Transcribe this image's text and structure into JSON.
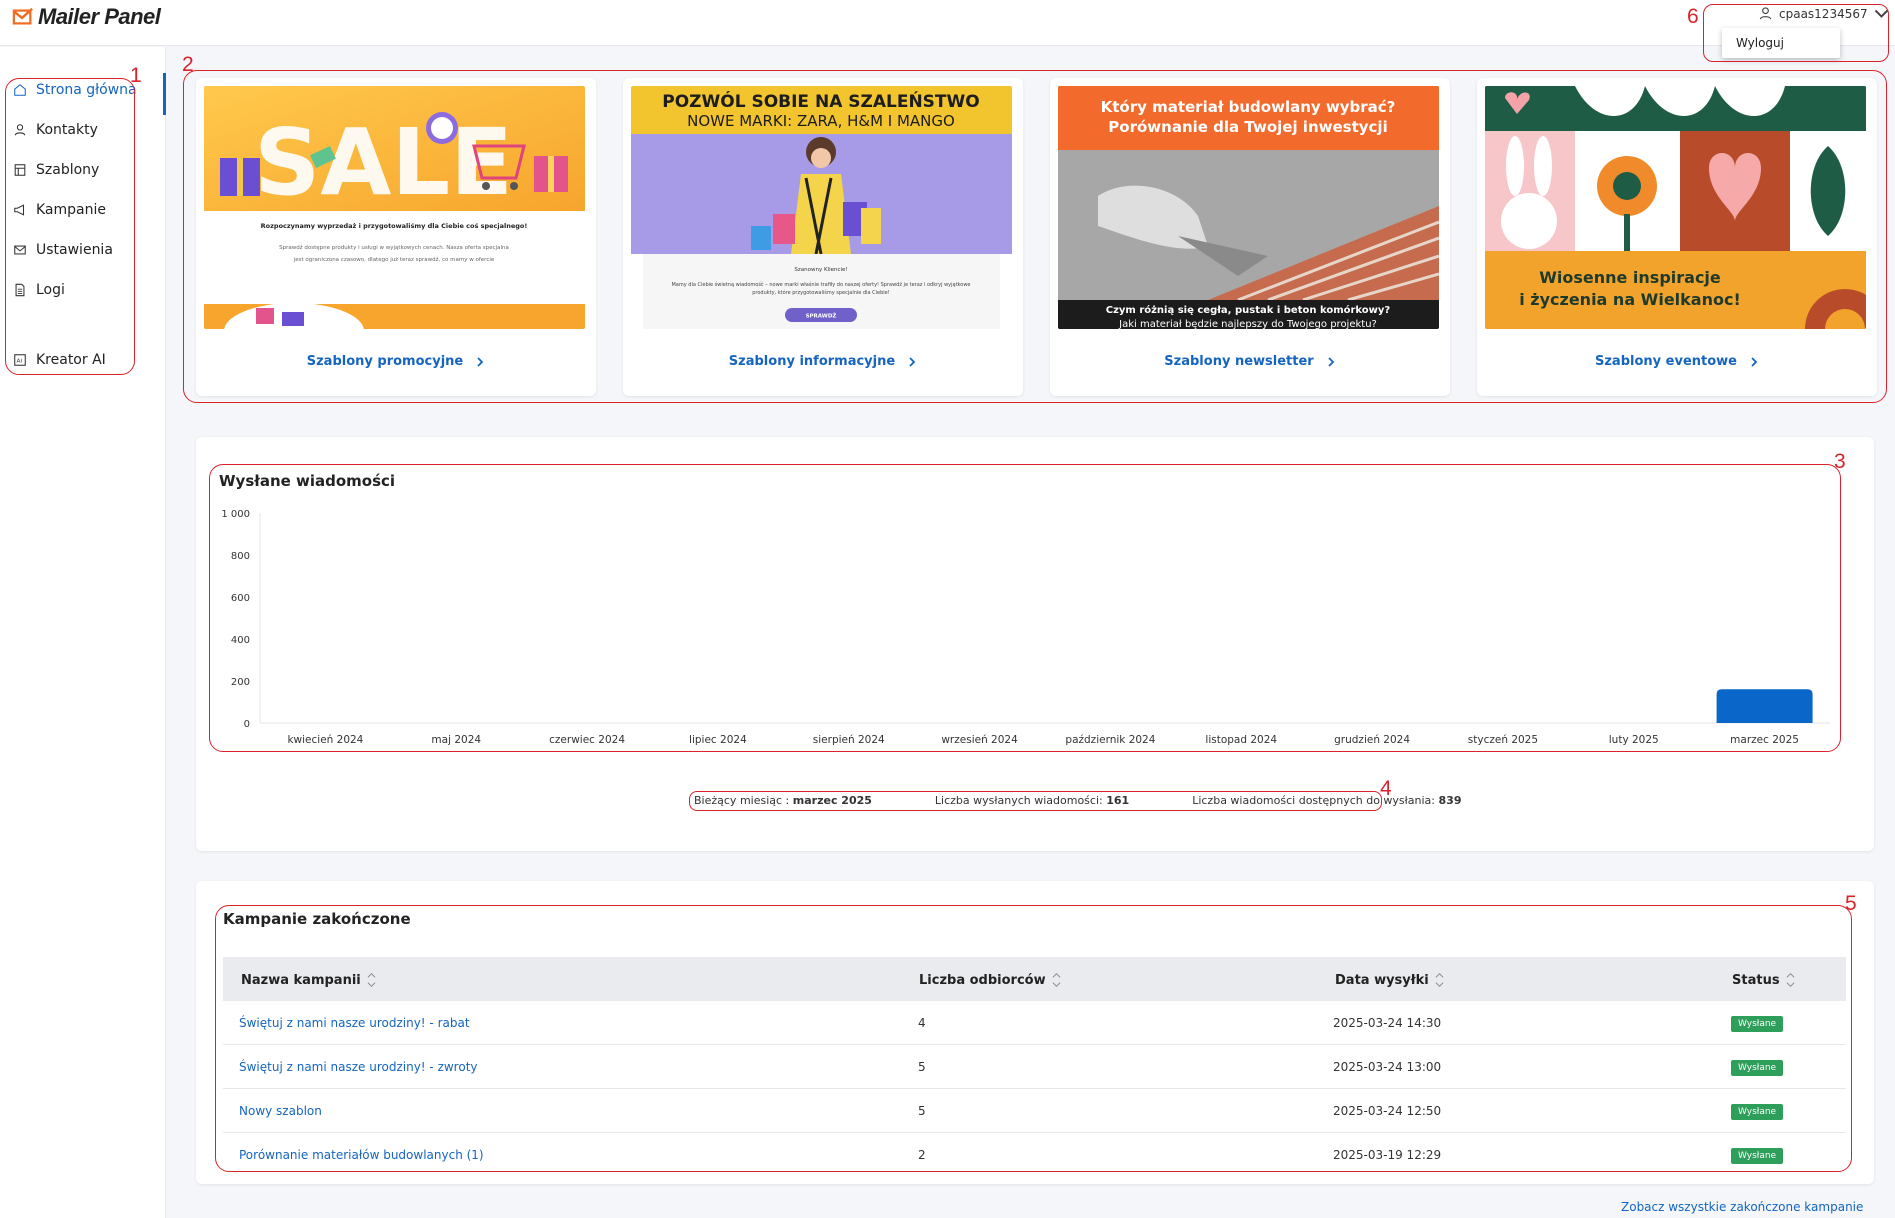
{
  "app": {
    "title": "Mailer Panel"
  },
  "user": {
    "name": "cpaas1234567",
    "logout": "Wyloguj"
  },
  "sidebar": {
    "items": [
      {
        "label": "Strona główna",
        "icon": "home-icon",
        "active": true
      },
      {
        "label": "Kontakty",
        "icon": "user-icon"
      },
      {
        "label": "Szablony",
        "icon": "template-icon"
      },
      {
        "label": "Kampanie",
        "icon": "megaphone-icon"
      },
      {
        "label": "Ustawienia",
        "icon": "mail-icon"
      },
      {
        "label": "Logi",
        "icon": "document-icon"
      },
      {
        "label": "Kreator AI",
        "icon": "ai-icon"
      }
    ]
  },
  "templates": [
    {
      "link": "Szablony promocyjne",
      "preview": {
        "headline": "SALE",
        "line1": "Rozpoczynamy wyprzedaż i przygotowaliśmy dla Ciebie coś specjalnego!",
        "line2": "Sprawdź dostępne produkty i usługi w wyjątkowych cenach. Nasza oferta specjalna",
        "line3": "jest ograniczona czasowo, dlatego już teraz sprawdź, co mamy w ofercie"
      }
    },
    {
      "link": "Szablony informacyjne",
      "preview": {
        "headline": "POZWÓL SOBIE NA SZALEŃSTWO",
        "sub": "NOWE MARKI: ZARA, H&M I MANGO",
        "greeting": "Szanowny Kliencie!",
        "line1": "Mamy dla Ciebie świetną wiadomość – nowe marki właśnie trafiły do naszej oferty! Sprawdź je teraz i odkryj wyjątkowe",
        "line2": "produkty, które przygotowaliśmy specjalnie dla Ciebie!",
        "button": "SPRAWDŹ"
      }
    },
    {
      "link": "Szablony newsletter",
      "preview": {
        "headline1": "Który materiał budowlany wybrać?",
        "headline2": "Porównanie dla Twojej inwestycji",
        "caption1": "Czym różnią się cegła, pustak i beton komórkowy?",
        "caption2": "Jaki materiał będzie najlepszy do Twojego projektu?"
      }
    },
    {
      "link": "Szablony eventowe",
      "preview": {
        "headline1": "Wiosenne inspiracje",
        "headline2": "i życzenia na Wielkanoc!"
      }
    }
  ],
  "chart_data": {
    "type": "bar",
    "title": "Wysłane wiadomości",
    "categories": [
      "kwiecień 2024",
      "maj 2024",
      "czerwiec 2024",
      "lipiec 2024",
      "sierpień 2024",
      "wrzesień 2024",
      "październik 2024",
      "listopad 2024",
      "grudzień 2024",
      "styczeń 2025",
      "luty 2025",
      "marzec 2025"
    ],
    "values": [
      0,
      0,
      0,
      0,
      0,
      0,
      0,
      0,
      0,
      0,
      0,
      161
    ],
    "yticks": [
      "0",
      "200",
      "400",
      "600",
      "800",
      "1 000"
    ],
    "ylim": [
      0,
      1000
    ],
    "bar_color": "#0a66c9",
    "grid": false
  },
  "summary": {
    "month_label": "Bieżący miesiąc :",
    "month_value": "marzec 2025",
    "sent_label": "Liczba wysłanych wiadomości:",
    "sent_value": "161",
    "available_label": "Liczba wiadomości dostępnych do wysłania:",
    "available_value": "839"
  },
  "campaigns": {
    "title": "Kampanie zakończone",
    "columns": [
      "Nazwa kampanii",
      "Liczba odbiorców",
      "Data wysyłki",
      "Status"
    ],
    "rows": [
      {
        "name": "Świętuj z nami nasze urodziny! - rabat",
        "recipients": "4",
        "date": "2025-03-24 14:30",
        "status": "Wysłane"
      },
      {
        "name": "Świętuj z nami nasze urodziny! - zwroty",
        "recipients": "5",
        "date": "2025-03-24 13:00",
        "status": "Wysłane"
      },
      {
        "name": "Nowy szablon",
        "recipients": "5",
        "date": "2025-03-24 12:50",
        "status": "Wysłane"
      },
      {
        "name": "Porównanie materiałów budowlanych (1)",
        "recipients": "2",
        "date": "2025-03-19 12:29",
        "status": "Wysłane"
      }
    ],
    "see_all": "Zobacz wszystkie zakończone kampanie"
  },
  "annotations": [
    "1",
    "2",
    "3",
    "4",
    "5",
    "6"
  ],
  "colors": {
    "accent": "#1565c0",
    "logo": "#f26b21",
    "annotation": "#d9232d",
    "status": "#2e9e5b"
  }
}
